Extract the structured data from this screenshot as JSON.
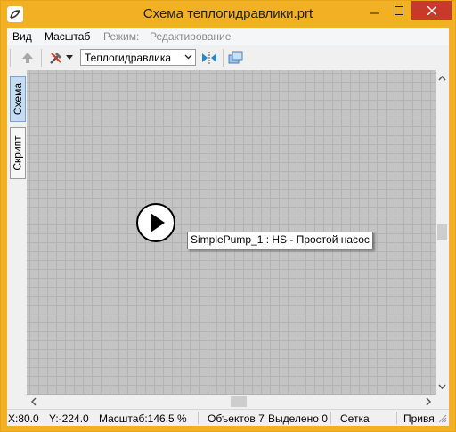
{
  "window": {
    "title": "Схема теплогидравлики.prt",
    "accent_color": "#f2b024",
    "close_color": "#c7392a"
  },
  "menu": {
    "items": [
      "Вид",
      "Масштаб"
    ],
    "mode_label": "Режим:",
    "mode_value": "Редактирование"
  },
  "toolbar": {
    "select_value": "Теплогидравлика",
    "icons": [
      "arrow-up-icon",
      "tools-icon",
      "dropdown-icon",
      "flip-icon",
      "layers-icon"
    ]
  },
  "side_tabs": [
    "Схема",
    "Скрипт"
  ],
  "canvas": {
    "grid_color": "#c4c4c4",
    "element_label": "SimplePump_1 : HS - Простой насос",
    "element_icon": "play-icon"
  },
  "status": {
    "x": "X:80.0",
    "y": "Y:-224.0",
    "scale": "Масштаб:146.5 %",
    "objects": "Объектов 7",
    "selected": "Выделено 0",
    "grid": "Сетка",
    "snap": "Привя"
  }
}
